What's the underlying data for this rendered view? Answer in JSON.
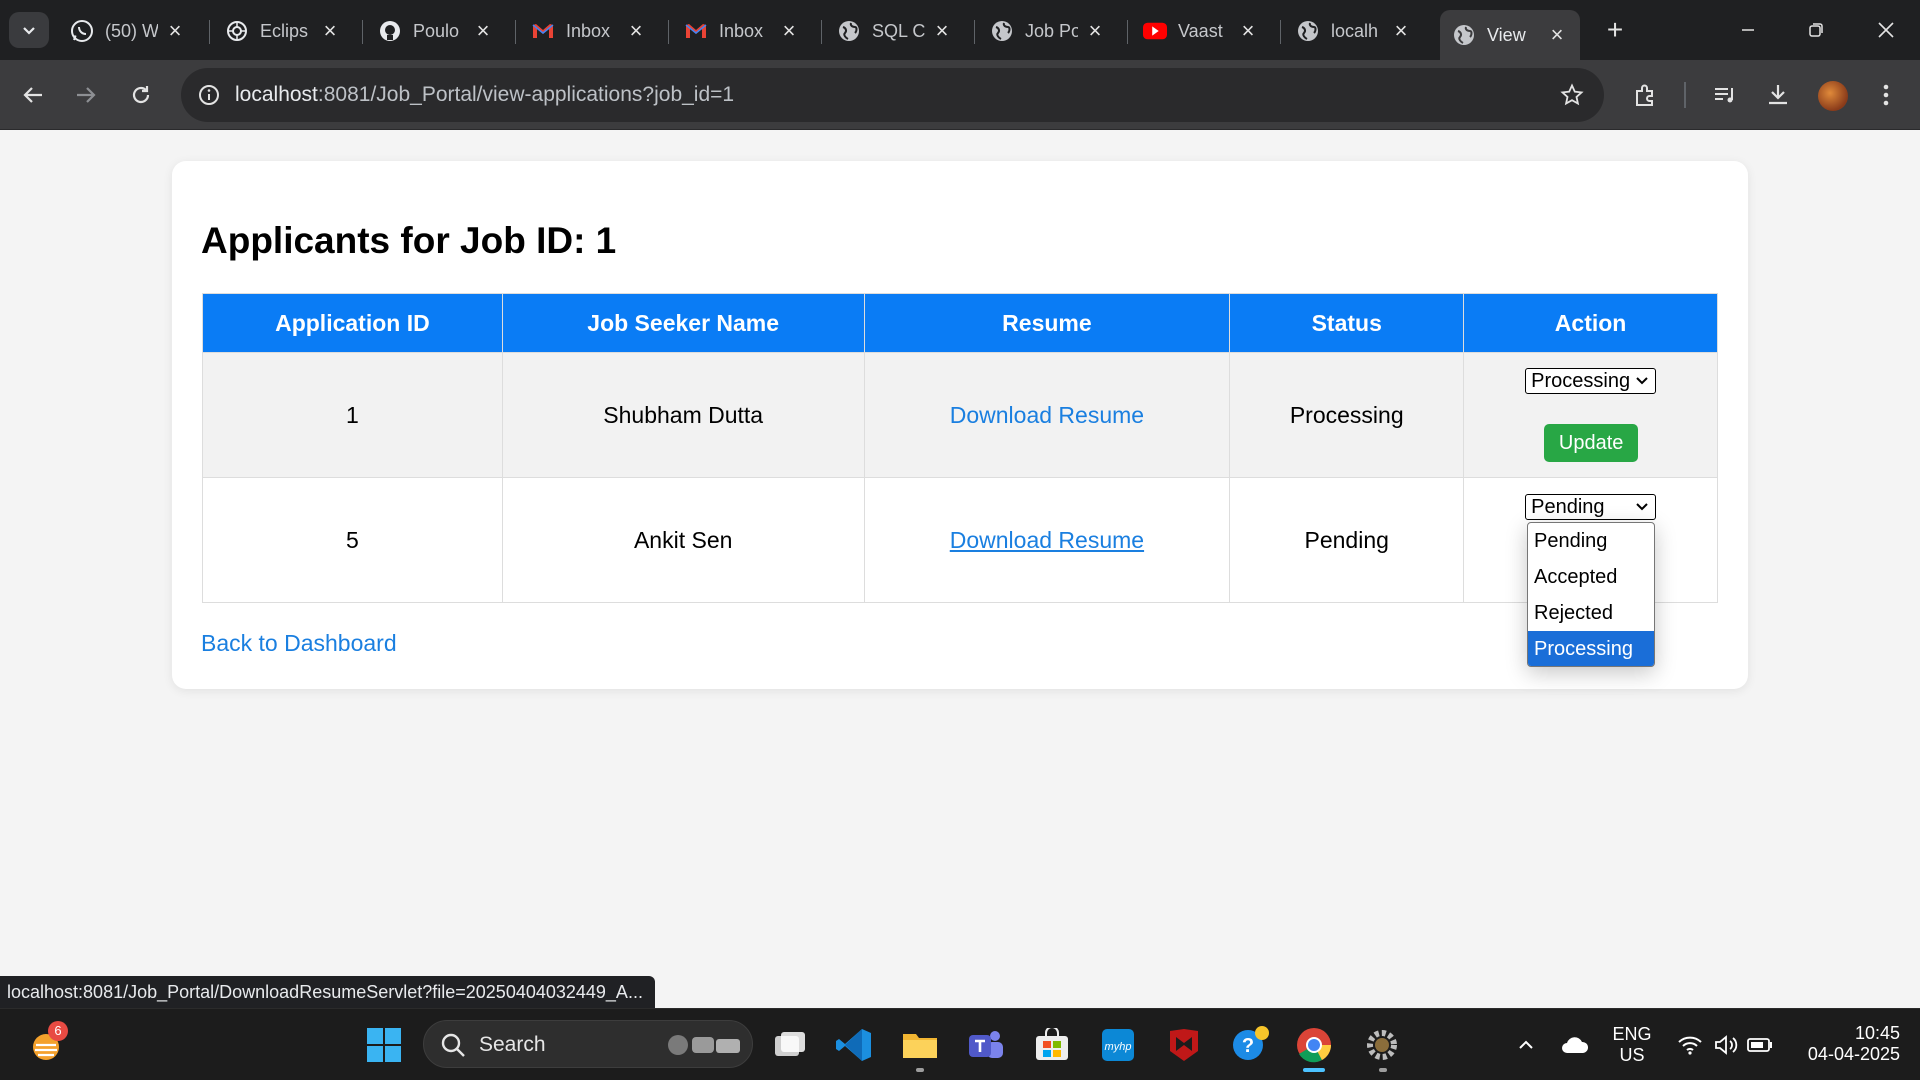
{
  "browser": {
    "tabs": [
      {
        "title": "(50) W",
        "icon": "whatsapp-icon"
      },
      {
        "title": "Eclips",
        "icon": "openai-icon"
      },
      {
        "title": "Poulo",
        "icon": "github-icon"
      },
      {
        "title": "Inbox",
        "icon": "gmail-icon"
      },
      {
        "title": "Inbox",
        "icon": "gmail-icon"
      },
      {
        "title": "SQL C",
        "icon": "globe-icon"
      },
      {
        "title": "Job Po",
        "icon": "globe-icon"
      },
      {
        "title": "Vaast",
        "icon": "youtube-icon"
      },
      {
        "title": "localh",
        "icon": "globe-icon"
      },
      {
        "title": "View",
        "icon": "globe-icon"
      }
    ],
    "url_host": "localhost",
    "url_rest": ":8081/Job_Portal/view-applications?job_id=1",
    "status_url": "localhost:8081/Job_Portal/DownloadResumeServlet?file=20250404032449_A..."
  },
  "page": {
    "title": "Applicants for Job ID: 1",
    "columns": [
      "Application ID",
      "Job Seeker Name",
      "Resume",
      "Status",
      "Action"
    ],
    "rows": [
      {
        "id": "1",
        "name": "Shubham Dutta",
        "resume": "Download Resume",
        "status": "Processing",
        "select_value": "Processing",
        "action_label": "Update"
      },
      {
        "id": "5",
        "name": "Ankit Sen",
        "resume": "Download Resume",
        "status": "Pending",
        "select_value": "Pending"
      }
    ],
    "dropdown_options": [
      "Pending",
      "Accepted",
      "Rejected",
      "Processing"
    ],
    "dropdown_highlighted": "Processing",
    "back_link": "Back to Dashboard"
  },
  "taskbar": {
    "weather_badge": "6",
    "search_label": "Search",
    "lang_top": "ENG",
    "lang_bottom": "US",
    "time": "10:45",
    "date": "04-04-2025"
  },
  "colors": {
    "header_blue": "#0a7cf5",
    "link_blue": "#1a7fe0",
    "update_green": "#28a745",
    "selected_option": "#1a6ed8"
  }
}
